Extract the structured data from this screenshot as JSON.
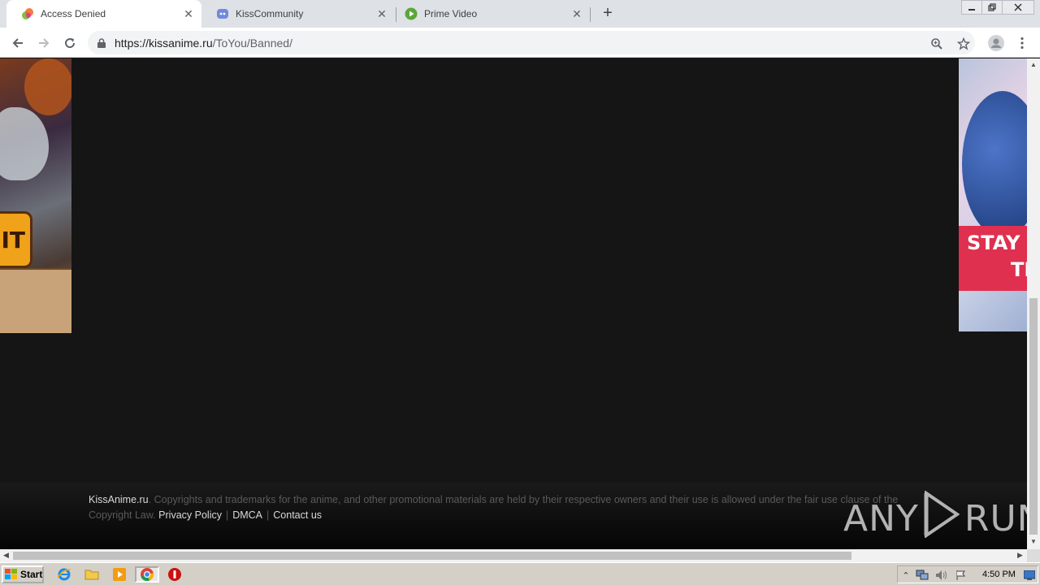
{
  "browser": {
    "tabs": [
      {
        "title": "Access Denied",
        "favicon": "kissanime-icon",
        "active": true
      },
      {
        "title": "KissCommunity",
        "favicon": "discord-icon",
        "active": false
      },
      {
        "title": "Prime Video",
        "favicon": "play-icon",
        "active": false
      }
    ],
    "new_tab": "+",
    "url_domain": "https://kissanime.ru",
    "url_path": "/ToYou/Banned/"
  },
  "ads": {
    "left_text": "IT",
    "right_text_1": "STAY",
    "right_text_2": "TI"
  },
  "footer": {
    "brand": "KissAnime.ru",
    "copyright_1": ". Copyrights and trademarks for the anime, and other promotional materials are held by their respective owners and their use is allowed under the fair use clause of the",
    "copyright_2": "Copyright Law.",
    "links": [
      "Privacy Policy",
      "DMCA",
      "Contact us"
    ]
  },
  "watermark": {
    "left": "ANY",
    "right": "RUN"
  },
  "taskbar": {
    "start_label": "Start",
    "clock": "4:50 PM"
  },
  "colors": {
    "page_bg": "#151515",
    "tab_strip": "#dee1e6",
    "taskbar": "#d4d0c8"
  }
}
